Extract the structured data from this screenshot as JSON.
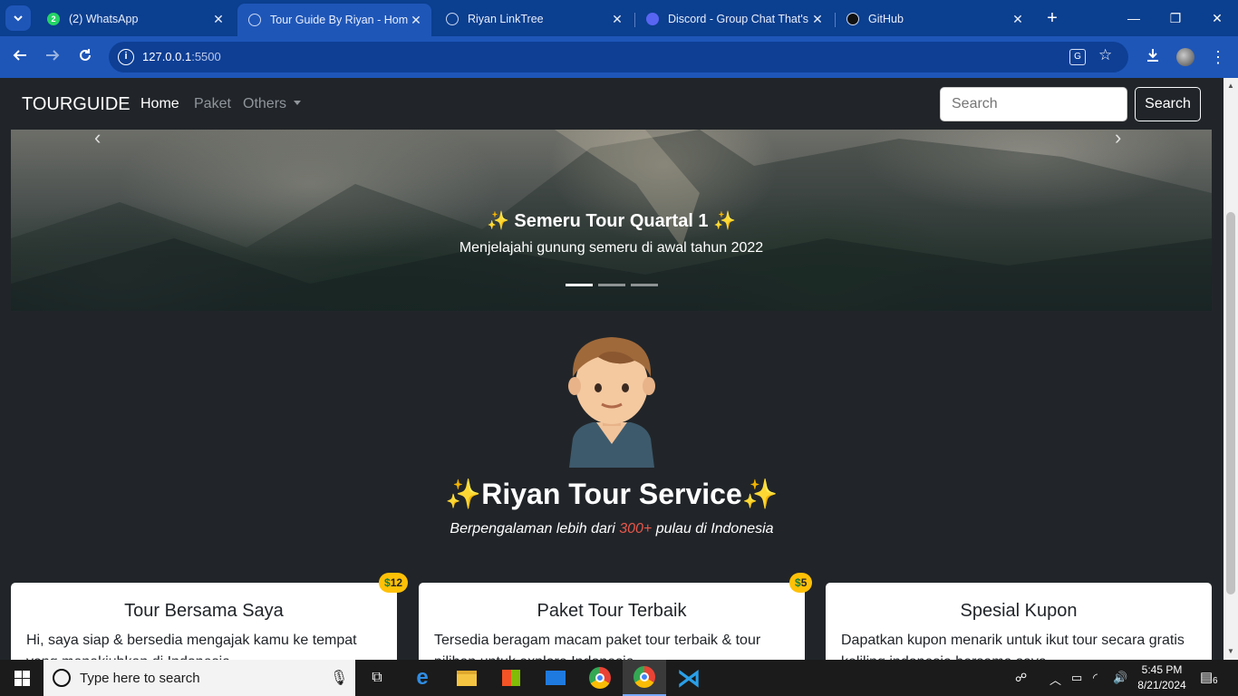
{
  "browser": {
    "tabs": [
      {
        "title": "(2) WhatsApp",
        "active": false,
        "icon": "whatsapp-icon",
        "badge": "2"
      },
      {
        "title": "Tour Guide By Riyan - Home",
        "active": true,
        "icon": "globe-icon"
      },
      {
        "title": "Riyan LinkTree",
        "active": false,
        "icon": "globe-icon"
      },
      {
        "title": "Discord - Group Chat That's",
        "active": false,
        "icon": "discord-icon"
      },
      {
        "title": "GitHub",
        "active": false,
        "icon": "github-icon"
      }
    ],
    "url_host": "127.0.0.1",
    "url_port": ":5500"
  },
  "navbar": {
    "brand": "TOURGUIDE",
    "links": [
      "Home",
      "Paket",
      "Others"
    ],
    "search_placeholder": "Search",
    "search_button": "Search"
  },
  "carousel": {
    "title": "✨ Semeru Tour Quartal 1 ✨",
    "text": "Menjelajahi gunung semeru di awal tahun 2022",
    "slide_count": 3,
    "active_index": 0
  },
  "hero": {
    "title": "✨Riyan Tour Service✨",
    "subtitle_before": "Berpengalaman lebih dari ",
    "subtitle_highlight": "300+",
    "subtitle_after": " pulau di Indonesia"
  },
  "cards": [
    {
      "title": "Tour Bersama Saya",
      "text": "Hi, saya siap & bersedia mengajak kamu ke tempat yang menakjubkan di Indonesia",
      "badge": "12"
    },
    {
      "title": "Paket Tour Terbaik",
      "text": "Tersedia beragam macam paket tour terbaik & tour pilihan untuk explore Indonesia",
      "badge": "5"
    },
    {
      "title": "Spesial Kupon",
      "text": "Dapatkan kupon menarik untuk ikut tour secara gratis keliling indonesia bersama saya",
      "badge": ""
    }
  ],
  "taskbar": {
    "search_placeholder": "Type here to search",
    "time": "5:45 PM",
    "date": "8/21/2024",
    "notification_count": "6"
  },
  "colors": {
    "tabbar": "#0b3f8f",
    "toolbar": "#1e56b8",
    "page_bg": "#212529",
    "badge": "#ffc107",
    "highlight": "#e8574b"
  }
}
